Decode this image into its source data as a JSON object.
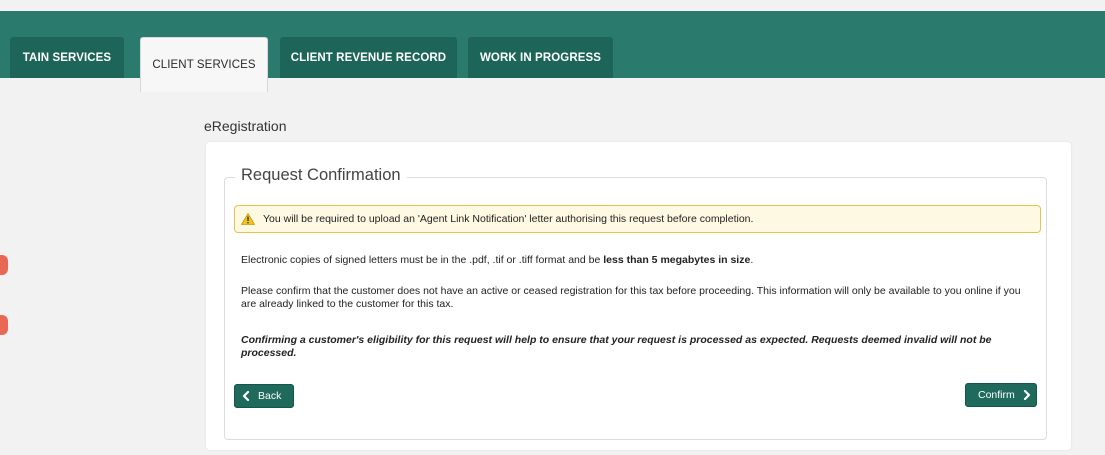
{
  "tabs": [
    {
      "label": "TAIN SERVICES"
    },
    {
      "label": "CLIENT SERVICES"
    },
    {
      "label": "CLIENT REVENUE RECORD"
    },
    {
      "label": "WORK IN PROGRESS"
    }
  ],
  "page": {
    "heading": "eRegistration"
  },
  "panel": {
    "legend": "Request Confirmation",
    "alert": "You will be required to upload an 'Agent Link Notification' letter authorising this request before completion.",
    "para1_prefix": "Electronic copies of signed letters must be in the .pdf, .tif or .tiff format and be ",
    "para1_bold": "less than 5 megabytes in size",
    "para1_suffix": ".",
    "para2": "Please confirm that the customer does not have an active or ceased registration for this tax before proceeding. This information will only be available to you online if you are already linked to the customer for this tax.",
    "para3": "Confirming a customer's eligibility for this request will help to ensure that your request is processed as expected. Requests deemed invalid will not be processed.",
    "back_label": "Back",
    "confirm_label": "Confirm"
  },
  "colors": {
    "brand": "#2a7a6d",
    "tab": "#1d6558",
    "button": "#1f6a5d",
    "alert_bg": "#fef9e3",
    "alert_border": "#e9c24e"
  }
}
